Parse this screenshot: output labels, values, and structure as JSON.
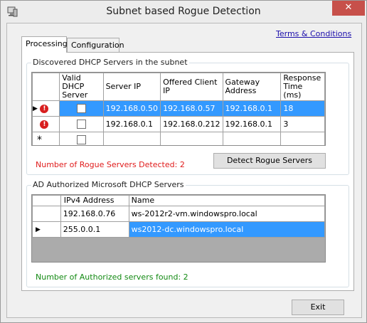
{
  "window": {
    "title": "Subnet based Rogue Detection",
    "close_label": "✕"
  },
  "links": {
    "terms": "Terms & Conditions"
  },
  "tabs": [
    {
      "label": "Processing"
    },
    {
      "label": "Configuration"
    }
  ],
  "discovered": {
    "group_title": "Discovered DHCP Servers in the subnet",
    "columns": [
      "Valid DHCP Server",
      "Server IP",
      "Offered Client IP",
      "Gateway Address",
      "Response Time (ms)"
    ],
    "rows": [
      {
        "server_ip": "192.168.0.50",
        "offered_ip": "192.168.0.57",
        "gateway": "192.168.0.1",
        "response": "18"
      },
      {
        "server_ip": "192.168.0.1",
        "offered_ip": "192.168.0.212",
        "gateway": "192.168.0.1",
        "response": "3"
      }
    ],
    "new_row_marker": "*",
    "rogue_count_text": "Number of Rogue Servers Detected: 2",
    "detect_button": "Detect Rogue Servers"
  },
  "authorized": {
    "group_title": "AD Authorized Microsoft DHCP Servers",
    "columns": [
      "IPv4 Address",
      "Name"
    ],
    "rows": [
      {
        "ip": "192.168.0.76",
        "name": "ws-2012r2-vm.windowspro.local"
      },
      {
        "ip": "255.0.0.1",
        "name": "ws2012-dc.windowspro.local"
      }
    ],
    "count_text": "Number of Authorized servers found: 2"
  },
  "exit_button": "Exit",
  "colors": {
    "selection": "#3399ff",
    "rogue_text": "#e01b1b",
    "auth_text": "#138a13",
    "close": "#c7504a"
  }
}
